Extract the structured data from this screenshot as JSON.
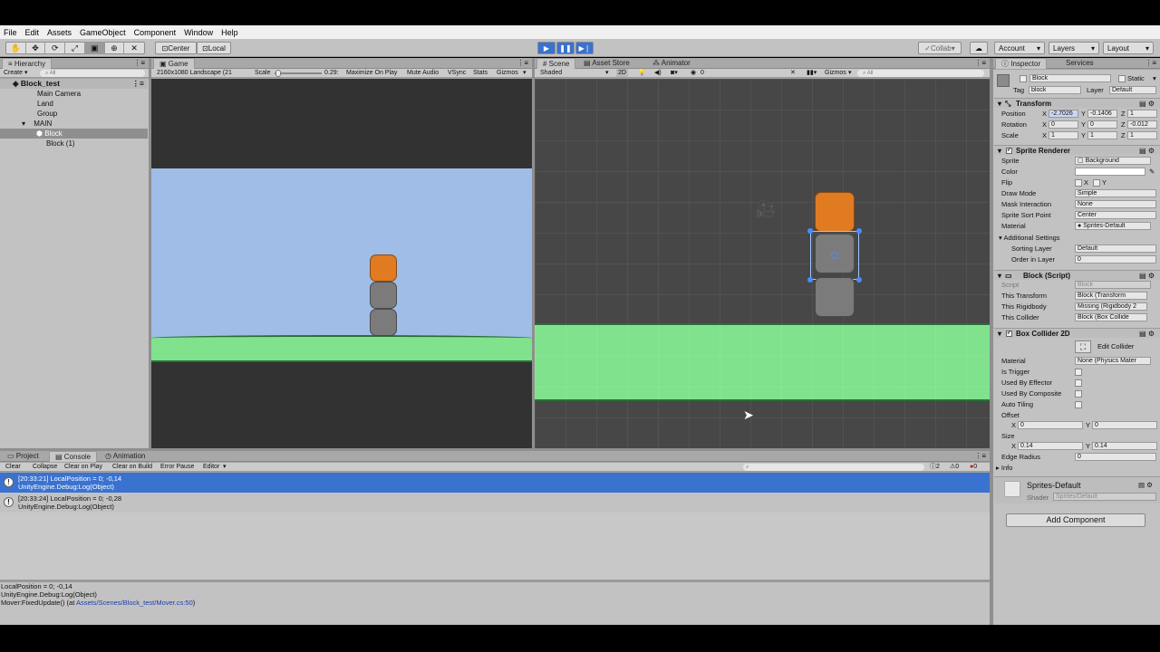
{
  "menu": {
    "items": [
      "File",
      "Edit",
      "Assets",
      "GameObject",
      "Component",
      "Window",
      "Help"
    ]
  },
  "toolbar": {
    "pivot": "Center",
    "space": "Local",
    "collab": "Collab",
    "account": "Account",
    "layers": "Layers",
    "layout": "Layout"
  },
  "hierarchy": {
    "tab": "Hierarchy",
    "create": "Create",
    "search_placeholder": "All",
    "scene": "Block_test",
    "items": [
      "Main Camera",
      "Land",
      "Group",
      "MAIN",
      "Block",
      "Block (1)"
    ]
  },
  "game": {
    "tab": "Game",
    "resolution": "2160x1080 Landscape (21",
    "scale_label": "Scale",
    "scale_value": "0.29:",
    "maximize": "Maximize On Play",
    "mute": "Mute Audio",
    "vsync": "VSync",
    "stats": "Stats",
    "gizmos": "Gizmos"
  },
  "scene_view": {
    "tabs": [
      "Scene",
      "Asset Store",
      "Animator"
    ],
    "shading": "Shaded",
    "mode_2d": "2D",
    "effects_count": "0",
    "gizmos": "Gizmos",
    "search_placeholder": "All"
  },
  "inspector": {
    "tabs": [
      "Inspector",
      "Services"
    ],
    "object_name": "Block",
    "static_label": "Static",
    "tag_label": "Tag",
    "tag": "block",
    "layer_label": "Layer",
    "layer": "Default",
    "transform": {
      "title": "Transform",
      "position_label": "Position",
      "rotation_label": "Rotation",
      "scale_label": "Scale",
      "position": {
        "x": "-2.7026",
        "y": "-0.1406",
        "z": "1"
      },
      "rotation": {
        "x": "0",
        "y": "0",
        "z": "-0.012"
      },
      "scale": {
        "x": "1",
        "y": "1",
        "z": "1"
      }
    },
    "sprite_renderer": {
      "title": "Sprite Renderer",
      "labels": [
        "Sprite",
        "Color",
        "Flip",
        "Draw Mode",
        "Mask Interaction",
        "Sprite Sort Point",
        "Material"
      ],
      "sprite": "Background",
      "flip_x": "X",
      "flip_y": "Y",
      "draw_mode": "Simple",
      "mask_interaction": "None",
      "sort_point": "Center",
      "material": "Sprites-Default",
      "additional": "Additional Settings",
      "sorting_layer_label": "Sorting Layer",
      "sorting_layer": "Default",
      "order_label": "Order in Layer",
      "order": "0"
    },
    "block_script": {
      "title": "Block (Script)",
      "labels": [
        "Script",
        "This Transform",
        "This Rigidbody",
        "This Collider"
      ],
      "script": "Block",
      "this_transform": "Block (Transform",
      "this_rigidbody": "Missing (Rigidbody 2",
      "this_collider": "Block (Box Collide"
    },
    "box_collider": {
      "title": "Box Collider 2D",
      "edit": "Edit Collider",
      "labels": [
        "Material",
        "Is Trigger",
        "Used By Effector",
        "Used By Composite",
        "Auto Tiling",
        "Offset"
      ],
      "material": "None (Physics Mater",
      "offset_x": "0",
      "offset_y": "0",
      "size_label": "Size",
      "size_x": "0.14",
      "size_y": "0.14",
      "edge_label": "Edge Radius",
      "edge": "0",
      "info": "Info"
    },
    "material_name": "Sprites-Default",
    "shader_label": "Shader",
    "shader": "Sprites/Default",
    "add_component": "Add Component"
  },
  "bottom": {
    "tabs": [
      "Project",
      "Console",
      "Animation"
    ],
    "buttons": [
      "Clear",
      "Collapse",
      "Clear on Play",
      "Clear on Build",
      "Error Pause",
      "Editor"
    ],
    "counts": {
      "warnings": "2",
      "errors1": "0",
      "errors2": "0"
    },
    "logs": [
      {
        "line1": "[20:33:21] LocalPosition = 0; -0,14",
        "line2": "UnityEngine.Debug:Log(Object)"
      },
      {
        "line1": "[20:33:24] LocalPosition = 0; -0,28",
        "line2": "UnityEngine.Debug:Log(Object)"
      }
    ],
    "detail": {
      "line1": "LocalPosition = 0; -0,14",
      "line2": "UnityEngine.Debug:Log(Object)",
      "line3_prefix": "Mover:FixedUpdate() (at ",
      "line3_link": "Assets/Scenes/Block_test/Mover.cs:50",
      "line3_suffix": ")"
    }
  },
  "colors": {
    "accent_blue": "#3a72d0",
    "orange_block": "#e07b22",
    "gray_block": "#7b7b7b",
    "ground": "#7fe08a",
    "sky": "#a0bde8"
  }
}
